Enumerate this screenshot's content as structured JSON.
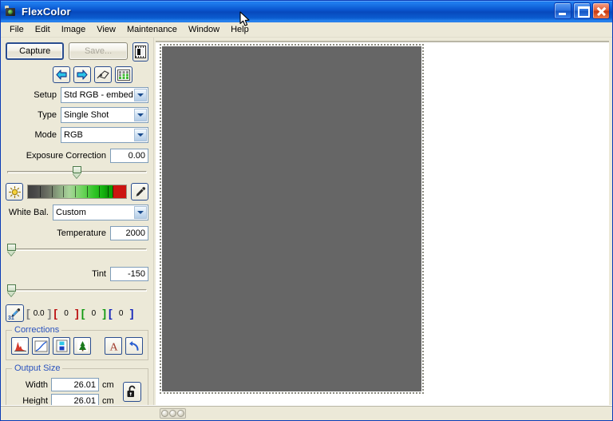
{
  "window": {
    "title": "FlexColor",
    "app_icon": "camera-icon",
    "minimize_label": "Minimize",
    "maximize_label": "Maximize",
    "close_label": "Close"
  },
  "menubar": {
    "items": [
      {
        "label": "File"
      },
      {
        "label": "Edit"
      },
      {
        "label": "Image"
      },
      {
        "label": "View"
      },
      {
        "label": "Maintenance"
      },
      {
        "label": "Window"
      },
      {
        "label": "Help"
      }
    ]
  },
  "toolbar": {
    "capture_label": "Capture",
    "capture_accel": "C",
    "save_label": "Save...",
    "film_button_icon": "film-frame-icon",
    "nav": [
      {
        "name": "previous",
        "icon": "arrow-left-icon"
      },
      {
        "name": "next",
        "icon": "arrow-right-icon"
      },
      {
        "name": "tag",
        "icon": "tag-icon"
      },
      {
        "name": "thumbnails",
        "icon": "grid-icon"
      }
    ]
  },
  "settings": {
    "setup": {
      "label": "Setup",
      "value": "Std RGB - embed"
    },
    "type": {
      "label": "Type",
      "value": "Single Shot"
    },
    "mode": {
      "label": "Mode",
      "value": "RGB"
    }
  },
  "exposure": {
    "label": "Exposure Correction",
    "value": "0.00",
    "slider_percent": 50
  },
  "white_balance": {
    "sun_button_icon": "sun-icon",
    "dropper_button_icon": "eyedropper-icon",
    "label": "White Bal.",
    "value": "Custom",
    "temperature": {
      "label": "Temperature",
      "value": "2000",
      "slider_percent": 0
    },
    "tint": {
      "label": "Tint",
      "value": "-150",
      "slider_percent": 0
    }
  },
  "readout": {
    "dropper_icon": "eyedropper-icon",
    "dropper_sub": "31",
    "density": "0.0",
    "red": "0",
    "green": "0",
    "blue": "0"
  },
  "corrections": {
    "title": "Corrections",
    "buttons": [
      {
        "name": "histogram",
        "icon": "histogram-icon"
      },
      {
        "name": "curves",
        "icon": "curve-icon"
      },
      {
        "name": "levels",
        "icon": "levels-icon"
      },
      {
        "name": "color-balance",
        "icon": "tree-icon"
      }
    ],
    "auto_label": "A",
    "auto_icon": "auto-letter-icon",
    "reset_icon": "undo-arrow-icon"
  },
  "output_size": {
    "title": "Output Size",
    "width": {
      "label": "Width",
      "value": "26.01",
      "unit": "cm"
    },
    "height": {
      "label": "Height",
      "value": "26.01",
      "unit": "cm"
    },
    "lock_icon": "open-padlock-icon"
  },
  "statusbar": {
    "indicators": [
      "status-dot-1",
      "status-dot-2",
      "status-dot-3"
    ]
  },
  "colors": {
    "titlebar_blue": "#0f4bd0",
    "panel_bg": "#ece9d8",
    "preview_gray": "#666666",
    "group_title_blue": "#2a52be",
    "accent_red": "#cc1410",
    "accent_green": "#0aa206"
  }
}
